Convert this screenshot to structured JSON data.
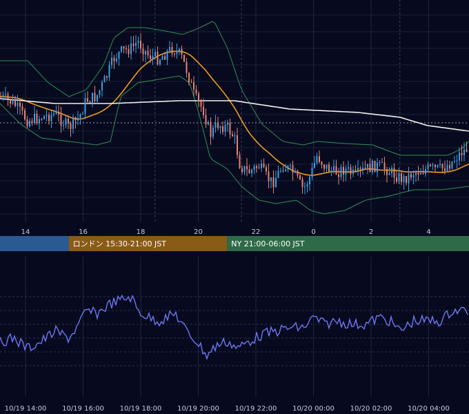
{
  "colors": {
    "background": "#070a1e",
    "up_candle": "#3aa0e6",
    "down_candle": "#e98373",
    "bollinger": "#2f8f57",
    "sma_short": "#f39c1f",
    "sma_long": "#f2f2f2",
    "oscillator": "#6f77f2",
    "session_tokyo": "#2a5a92",
    "session_london": "#8a5a17",
    "session_ny": "#2f6a48"
  },
  "sessions": [
    {
      "label": "",
      "color_key": "session_tokyo"
    },
    {
      "label": "ロンドン 15:30-21:00 JST",
      "color_key": "session_london"
    },
    {
      "label": "NY 21:00-06:00 JST",
      "color_key": "session_ny"
    }
  ],
  "chart_data": [
    {
      "type": "candlestick",
      "x_tick_labels": [
        "14",
        "16",
        "18",
        "20",
        "22",
        "0",
        "2",
        "4"
      ],
      "session_boundaries_hour": [
        15.5,
        21.0
      ],
      "marker_lines_hour": [
        18.5,
        21.5,
        3.0
      ],
      "grid": true
    },
    {
      "type": "line",
      "x_tick_labels": [
        "10/19 14:00",
        "10/19 16:00",
        "10/19 18:00",
        "10/19 20:00",
        "10/19 22:00",
        "10/20 00:00",
        "10/20 02:00",
        "10/20 04:00"
      ],
      "grid": true
    }
  ]
}
